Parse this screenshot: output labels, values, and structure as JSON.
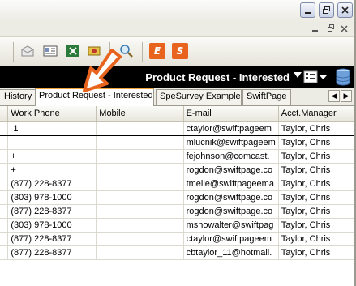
{
  "window": {
    "minimize_icon": "minimize-icon",
    "restore_icon": "restore-icon",
    "close_icon": "close-icon"
  },
  "mdi": {
    "minimize_icon": "minimize-icon",
    "restore_icon": "restore-icon",
    "close_icon": "close-icon"
  },
  "toolbar": {
    "icons": [
      "envelope-icon",
      "contact-card-icon",
      "excel-icon",
      "mail-merge-icon",
      "search-icon",
      "e-icon",
      "s-icon"
    ],
    "e_label": "E",
    "s_label": "S",
    "accent_orange": "#e8641e"
  },
  "view": {
    "title": "Product Request - Interested",
    "background": "#000000"
  },
  "tabs": [
    {
      "label": "History",
      "active": false
    },
    {
      "label": "Product Request - Interested",
      "active": true
    },
    {
      "label": "SpeSurvey Example",
      "active": false
    },
    {
      "label": "SwiftPage",
      "active": false
    }
  ],
  "grid": {
    "columns": [
      "Work Phone",
      "Mobile",
      "E-mail",
      "Acct.Manager"
    ],
    "rows": [
      [
        "1",
        "",
        "ctaylor@swiftpageem",
        "Taylor, Chris"
      ],
      [
        "",
        "",
        "mlucnik@swiftpageem",
        "Taylor, Chris"
      ],
      [
        "+",
        "",
        "fejohnson@comcast.",
        "Taylor, Chris"
      ],
      [
        "+",
        "",
        "rogdon@swiftpage.co",
        "Taylor, Chris"
      ],
      [
        "(877) 228-8377",
        "",
        "tmeile@swiftpageema",
        "Taylor, Chris"
      ],
      [
        "(303) 978-1000",
        "",
        "rogdon@swiftpage.co",
        "Taylor, Chris"
      ],
      [
        "(877) 228-8377",
        "",
        "rogdon@swiftpage.co",
        "Taylor, Chris"
      ],
      [
        "(303) 978-1000",
        "",
        "mshowalter@swiftpag",
        "Taylor, Chris"
      ],
      [
        "(877) 228-8377",
        "",
        "ctaylor@swiftpageem",
        "Taylor, Chris"
      ],
      [
        "(877) 228-8377",
        "",
        "cbtaylor_11@hotmail.",
        "Taylor, Chris"
      ]
    ]
  },
  "annotation_arrow_color": "#e8641e"
}
